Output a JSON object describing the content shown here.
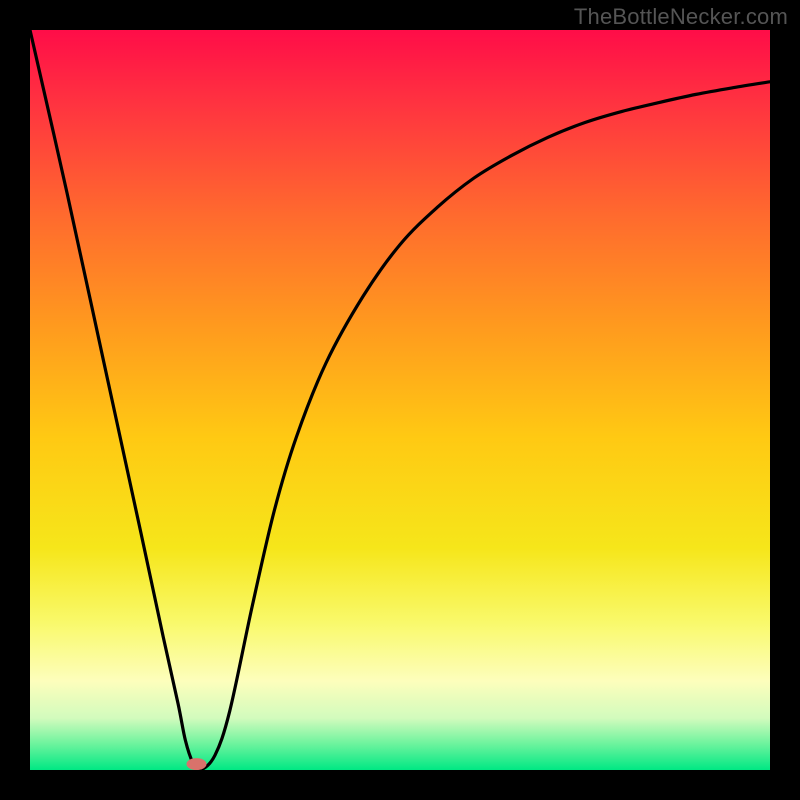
{
  "watermark": "TheBottleNecker.com",
  "chart_data": {
    "type": "line",
    "title": "",
    "xlabel": "",
    "ylabel": "",
    "xlim": [
      0,
      100
    ],
    "ylim": [
      0,
      100
    ],
    "series": [
      {
        "name": "curve",
        "x": [
          0,
          5,
          10,
          15,
          18,
          20,
          21,
          22,
          23,
          25,
          27,
          30,
          33,
          36,
          40,
          45,
          50,
          55,
          60,
          65,
          70,
          75,
          80,
          85,
          90,
          95,
          100
        ],
        "y": [
          100,
          78,
          55,
          32,
          18,
          9,
          4,
          1,
          0,
          2,
          8,
          22,
          35,
          45,
          55,
          64,
          71,
          76,
          80,
          83,
          85.5,
          87.5,
          89,
          90.2,
          91.3,
          92.2,
          93
        ]
      }
    ],
    "marker": {
      "x": 22.5,
      "y": 0.8,
      "color": "#d9726b"
    },
    "gradient_stops": [
      {
        "offset": 0.0,
        "color": "#ff0d48"
      },
      {
        "offset": 0.1,
        "color": "#ff3340"
      },
      {
        "offset": 0.25,
        "color": "#ff6a2e"
      },
      {
        "offset": 0.4,
        "color": "#ff9a1e"
      },
      {
        "offset": 0.55,
        "color": "#ffc913"
      },
      {
        "offset": 0.7,
        "color": "#f6e61a"
      },
      {
        "offset": 0.8,
        "color": "#f9f96a"
      },
      {
        "offset": 0.88,
        "color": "#fdfebc"
      },
      {
        "offset": 0.93,
        "color": "#d2fbbd"
      },
      {
        "offset": 0.965,
        "color": "#6cf39d"
      },
      {
        "offset": 1.0,
        "color": "#00e884"
      }
    ]
  }
}
